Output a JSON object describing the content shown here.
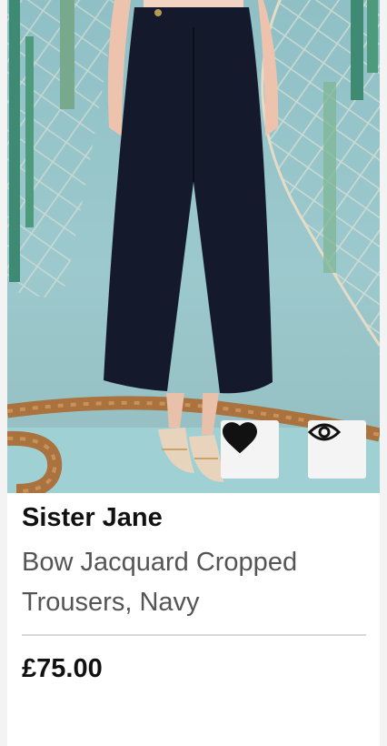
{
  "product": {
    "brand": "Sister Jane",
    "title": "Bow Jacquard Cropped Trousers, Navy",
    "price": "£75.00",
    "image_alt": "Model wearing navy bow jacquard cropped trousers",
    "actions": {
      "wishlist_icon": "heart-icon",
      "quickview_icon": "eye-icon"
    }
  },
  "colors": {
    "trousers": "#141a2b",
    "backdrop": "#9cc9cd",
    "text_primary": "#111111",
    "text_secondary": "#555555"
  }
}
